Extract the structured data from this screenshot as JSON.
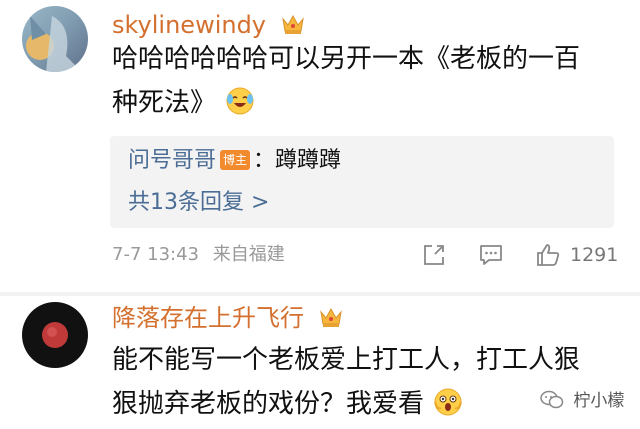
{
  "comments": [
    {
      "username": "skylinewindy",
      "text_line1": "哈哈哈哈哈哈可以另开一本《老板的一百",
      "text_line2": "种死法》",
      "reply": {
        "user": "问号哥哥",
        "badge": "博主",
        "separator": "：",
        "text": "蹲蹲蹲"
      },
      "more_replies": "共13条回复 >",
      "timestamp": "7-7 13:43",
      "location": "来自福建",
      "likes": "1291"
    },
    {
      "username": "降落存在上升飞行",
      "text_line1": "能不能写一个老板爱上打工人，打工人狠",
      "text_line2": "狠抛弃老板的戏份？我爱看"
    }
  ],
  "watermark": "柠小檬",
  "icons": {
    "crown": "crown-icon",
    "share": "share-icon",
    "reply": "comment-icon",
    "like": "thumbs-up-icon",
    "emoji_1": "laughing-emoji-icon",
    "emoji_2": "shocked-emoji-icon",
    "watermark": "wechat-icon"
  },
  "colors": {
    "username": "#d4702f",
    "link": "#4b6d95",
    "badge": "#f28a2e",
    "meta": "#999999"
  }
}
